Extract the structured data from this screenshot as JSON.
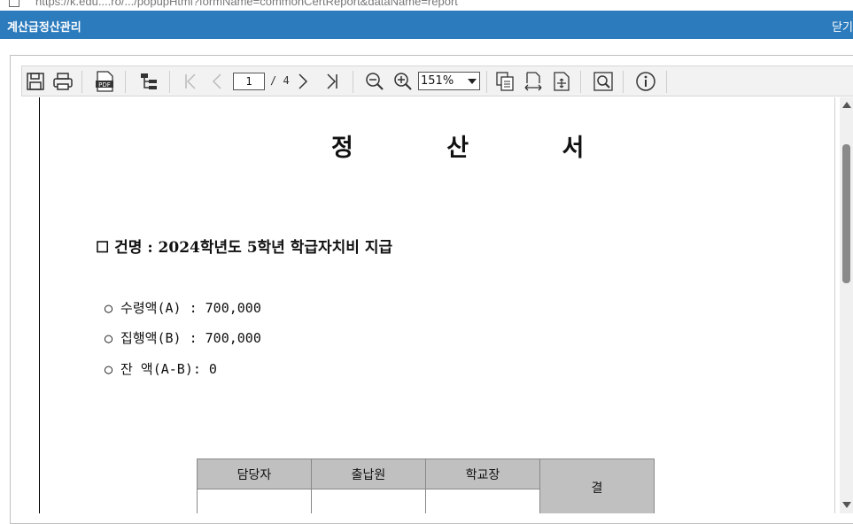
{
  "browser": {
    "url_fragment": "https://k.edu....ro/.../popupHtml?formName=commonCertReport&dataName=report"
  },
  "window": {
    "title": "계산급정산관리",
    "close_label": "닫기"
  },
  "toolbar": {
    "icons": [
      "save-icon",
      "print-icon",
      "pdf-icon",
      "tree-icon",
      "first-page-icon",
      "prev-page-icon",
      "next-page-icon",
      "last-page-icon",
      "zoom-out-icon",
      "zoom-in-icon",
      "single-page-icon",
      "fit-width-icon",
      "fit-page-icon",
      "search-icon",
      "info-icon"
    ],
    "pdf_label": "PDF",
    "current_page": "1",
    "total_pages": "/ 4",
    "zoom": "151%"
  },
  "document": {
    "title": "정 산 서",
    "subject": "☐ 건명 : 2024학년도 5학년 학급자치비 지급",
    "items": [
      "○ 수령액(A) : 700,000",
      "○ 집행액(B) : 700,000",
      "○ 잔 액(A-B): 0"
    ],
    "approval": {
      "headers": [
        "담당자",
        "출납원",
        "학교장"
      ],
      "side_label": "결"
    }
  },
  "colors": {
    "titlebar": "#2b7bbd",
    "table_header": "#c0c0c0"
  }
}
